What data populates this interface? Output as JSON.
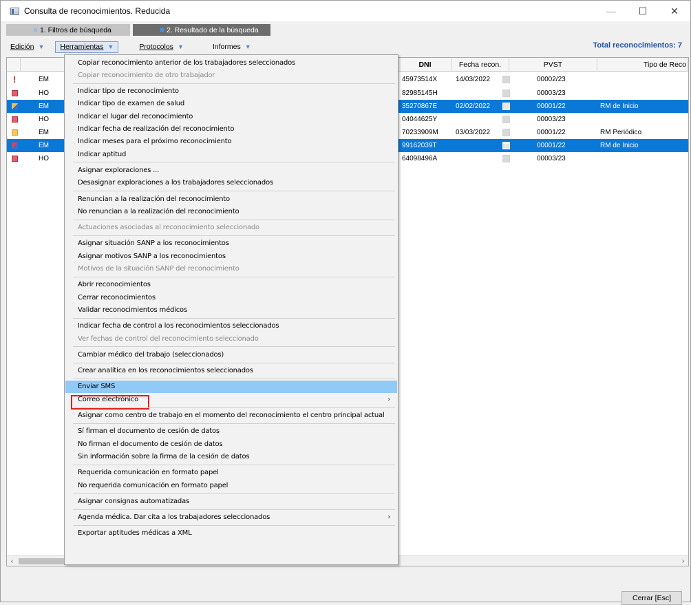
{
  "window": {
    "title": "Consulta de reconocimientos. Reducida",
    "controls": [
      "—",
      "☐",
      "✕"
    ]
  },
  "tabs": [
    {
      "label": "1. Filtros de búsqueda",
      "active": false
    },
    {
      "label": "2. Resultado de la búsqueda",
      "active": true
    }
  ],
  "menubar": {
    "items": [
      {
        "label": "Edición",
        "caret": "▼"
      },
      {
        "label": "Herramientas",
        "caret": "▼"
      },
      {
        "label": "Protocolos",
        "caret": "▼"
      },
      {
        "label": "Informes",
        "caret": "▼"
      }
    ],
    "total": "Total reconocimientos: 7"
  },
  "grid": {
    "columns": [
      "DNI",
      "Fecha recon.",
      "PVST",
      "Tipo de Reco"
    ],
    "rows": [
      {
        "status": "red-exclamation",
        "col2": "EM",
        "dni": "45973514X",
        "fecha": "14/03/2022",
        "pvst": "00002/23",
        "tipo": "",
        "selected": false
      },
      {
        "status": "red-square",
        "col2": "HO",
        "dni": "82985145H",
        "fecha": "",
        "pvst": "00003/23",
        "tipo": "",
        "selected": false
      },
      {
        "status": "yellow-blue",
        "col2": "EM",
        "dni": "35270867E",
        "fecha": "02/02/2022",
        "pvst": "00001/22",
        "tipo": "RM de Inicio",
        "selected": true
      },
      {
        "status": "red-square",
        "col2": "HO",
        "dni": "04044625Y",
        "fecha": "",
        "pvst": "00003/23",
        "tipo": "",
        "selected": false
      },
      {
        "status": "yellow",
        "col2": "EM",
        "dni": "70233909M",
        "fecha": "03/03/2022",
        "pvst": "00001/22",
        "tipo": "RM Periódico",
        "selected": false
      },
      {
        "status": "red-blue",
        "col2": "EM",
        "dni": "99162039T",
        "fecha": "",
        "pvst": "00001/22",
        "tipo": "RM de Inicio",
        "selected": true
      },
      {
        "status": "red-square",
        "col2": "HO",
        "dni": "64098496A",
        "fecha": "",
        "pvst": "00003/23",
        "tipo": "",
        "selected": false
      }
    ]
  },
  "dropdown": {
    "items": [
      {
        "label": "Copiar reconocimiento anterior de los trabajadores seleccionados",
        "disabled": false
      },
      {
        "label": "Copiar reconocimiento de otro trabajador",
        "disabled": true
      },
      {
        "sep": true
      },
      {
        "label": "Indicar tipo de reconocimiento",
        "disabled": false
      },
      {
        "label": "Indicar tipo de examen de salud",
        "disabled": false
      },
      {
        "label": "Indicar el lugar del reconocimiento",
        "disabled": false
      },
      {
        "label": "Indicar fecha de realización del reconocimiento",
        "disabled": false
      },
      {
        "label": "Indicar meses para el próximo reconocimiento",
        "disabled": false
      },
      {
        "label": "Indicar aptitud",
        "disabled": false
      },
      {
        "sep": true
      },
      {
        "label": "Asignar exploraciones ...",
        "disabled": false
      },
      {
        "label": "Desasignar exploraciones a los trabajadores seleccionados",
        "disabled": false
      },
      {
        "sep": true
      },
      {
        "label": "Renuncian a la realización del reconocimiento",
        "disabled": false
      },
      {
        "label": "No renuncian a la realización del reconocimiento",
        "disabled": false
      },
      {
        "sep": true
      },
      {
        "label": "Actuaciones asociadas al reconocimiento seleccionado",
        "disabled": true
      },
      {
        "sep": true
      },
      {
        "label": "Asignar situación SANP a los reconocimientos",
        "disabled": false
      },
      {
        "label": "Asignar motivos SANP a los reconocimientos",
        "disabled": false
      },
      {
        "label": "Motivos de la situación SANP del reconocimiento",
        "disabled": true
      },
      {
        "sep": true
      },
      {
        "label": "Abrir reconocimientos",
        "disabled": false
      },
      {
        "label": "Cerrar reconocimientos",
        "disabled": false
      },
      {
        "label": "Validar reconocimientos médicos",
        "disabled": false
      },
      {
        "sep": true
      },
      {
        "label": "Indicar fecha de control a los reconocimientos seleccionados",
        "disabled": false
      },
      {
        "label": "Ver fechas de control del reconocimiento seleccionado",
        "disabled": true
      },
      {
        "sep": true
      },
      {
        "label": "Cambiar médico del trabajo (seleccionados)",
        "disabled": false
      },
      {
        "sep": true
      },
      {
        "label": "Crear analítica en los reconocimientos seleccionados",
        "disabled": false
      },
      {
        "sep": true
      },
      {
        "label": "Enviar SMS",
        "disabled": false,
        "highlighted": true
      },
      {
        "label": "Correo electrónico",
        "disabled": false,
        "submenu": "›"
      },
      {
        "sep": true
      },
      {
        "label": "Asignar como centro de trabajo en el momento del reconocimiento el centro principal actual",
        "disabled": false
      },
      {
        "sep": true
      },
      {
        "label": "Sí firman el documento de cesión de datos",
        "disabled": false
      },
      {
        "label": "No firman el documento de cesión de datos",
        "disabled": false
      },
      {
        "label": "Sin información sobre la firma de la cesión de datos",
        "disabled": false
      },
      {
        "sep": true
      },
      {
        "label": "Requerida comunicación en formato papel",
        "disabled": false
      },
      {
        "label": "No requerida comunicación en formato papel",
        "disabled": false
      },
      {
        "sep": true
      },
      {
        "label": "Asignar consignas automatizadas",
        "disabled": false
      },
      {
        "sep": true
      },
      {
        "label": "Agenda médica. Dar cita a los trabajadores seleccionados",
        "disabled": false,
        "submenu": "›"
      },
      {
        "sep": true
      },
      {
        "label": "Exportar aptitudes médicas a XML",
        "disabled": false
      }
    ]
  },
  "scroll": {
    "left": "‹",
    "right": "›"
  },
  "footer": {
    "close_label": "Cerrar [Esc]"
  },
  "colors": {
    "selection": "#0a78d7",
    "highlight": "#91c9f7",
    "total": "#1f4fa8",
    "red_box": "#e02020"
  }
}
